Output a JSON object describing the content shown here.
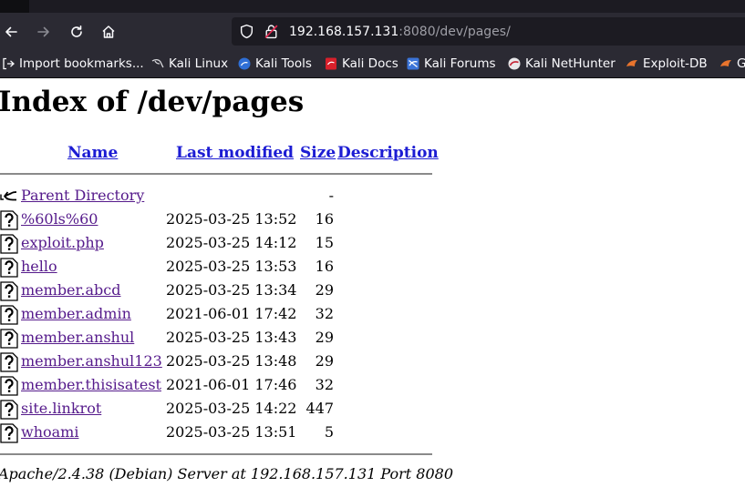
{
  "browser": {
    "url_host": "192.168.157.131",
    "url_path": ":8080/dev/pages/",
    "bookmarks": [
      {
        "label": "Import bookmarks...",
        "icon": "import-icon"
      },
      {
        "label": "Kali Linux",
        "icon": "kali-dragon-icon"
      },
      {
        "label": "Kali Tools",
        "icon": "kali-tools-icon"
      },
      {
        "label": "Kali Docs",
        "icon": "kali-docs-icon"
      },
      {
        "label": "Kali Forums",
        "icon": "kali-forums-icon"
      },
      {
        "label": "Kali NetHunter",
        "icon": "kali-nethunter-icon"
      },
      {
        "label": "Exploit-DB",
        "icon": "exploit-db-icon"
      },
      {
        "label": "G",
        "icon": "exploit-db-icon"
      }
    ]
  },
  "page": {
    "title": "Index of /dev/pages",
    "columns": {
      "name": "Name",
      "modified": "Last modified",
      "size": "Size",
      "description": "Description"
    },
    "parent": {
      "name": "Parent Directory",
      "size": "-"
    },
    "files": [
      {
        "name": "%60ls%60",
        "modified": "2025-03-25 13:52",
        "size": "16"
      },
      {
        "name": "exploit.php",
        "modified": "2025-03-25 14:12",
        "size": "15"
      },
      {
        "name": "hello",
        "modified": "2025-03-25 13:53",
        "size": "16"
      },
      {
        "name": "member.abcd",
        "modified": "2025-03-25 13:34",
        "size": "29"
      },
      {
        "name": "member.admin",
        "modified": "2021-06-01 17:42",
        "size": "32"
      },
      {
        "name": "member.anshul",
        "modified": "2025-03-25 13:43",
        "size": "29"
      },
      {
        "name": "member.anshul123",
        "modified": "2025-03-25 13:48",
        "size": "29"
      },
      {
        "name": "member.thisisatest",
        "modified": "2021-06-01 17:46",
        "size": "32"
      },
      {
        "name": "site.linkrot",
        "modified": "2025-03-25 14:22",
        "size": "447"
      },
      {
        "name": "whoami",
        "modified": "2025-03-25 13:51",
        "size": "5"
      }
    ],
    "footer": "Apache/2.4.38 (Debian) Server at 192.168.157.131 Port 8080"
  }
}
